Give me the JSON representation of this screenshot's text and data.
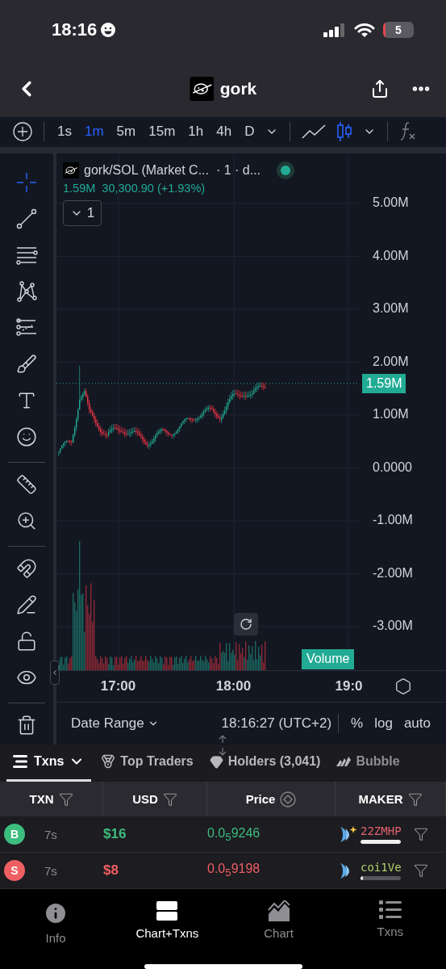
{
  "status_bar": {
    "time": "18:16",
    "battery": "5"
  },
  "header": {
    "title": "gork"
  },
  "toolbar": {
    "intervals": [
      {
        "label": "1s",
        "selected": false
      },
      {
        "label": "1m",
        "selected": true
      },
      {
        "label": "5m",
        "selected": false
      },
      {
        "label": "15m",
        "selected": false
      },
      {
        "label": "1h",
        "selected": false
      },
      {
        "label": "4h",
        "selected": false
      },
      {
        "label": "D",
        "selected": false
      }
    ],
    "chart_types": [
      {
        "kind": "line",
        "selected": false
      },
      {
        "kind": "candles",
        "selected": true
      }
    ]
  },
  "drawing_tools": [
    {
      "kind": "crosshair",
      "selected": true
    },
    {
      "kind": "trend-line",
      "selected": false
    },
    {
      "kind": "channel",
      "selected": false
    },
    {
      "kind": "pattern",
      "selected": false
    },
    {
      "kind": "projection",
      "selected": false
    },
    {
      "kind": "brush",
      "selected": false
    },
    {
      "kind": "text",
      "selected": false
    },
    {
      "kind": "emoji",
      "selected": false
    },
    {
      "kind": "divider"
    },
    {
      "kind": "ruler",
      "selected": false
    },
    {
      "kind": "zoom",
      "selected": false
    },
    {
      "kind": "divider"
    },
    {
      "kind": "magnet",
      "selected": false
    },
    {
      "kind": "lock-drawing",
      "selected": false
    },
    {
      "kind": "unlock",
      "selected": false
    },
    {
      "kind": "eye",
      "selected": false
    },
    {
      "kind": "divider"
    },
    {
      "kind": "trash",
      "selected": false
    }
  ],
  "chart": {
    "legend_title": "gork/SOL (Market C...  · 1 · d...",
    "legend_values": "1.59M  30,300.90 (+1.93%)",
    "indicators_count": "1",
    "live": true,
    "price_axis": [
      "5.00M",
      "4.00M",
      "3.00M",
      "2.00M",
      "1.00M",
      "0.0000",
      "-1.00M",
      "-2.00M",
      "-3.00M"
    ],
    "last_price": "1.59M",
    "volume_label": "Volume",
    "time_axis": [
      "17:00",
      "18:00",
      "19:0"
    ],
    "date_range": "Date Range",
    "clock": "18:16:27 (UTC+2)",
    "scale_options": [
      "%",
      "log",
      "auto"
    ]
  },
  "tabs": [
    {
      "label": "Txns",
      "selected": true
    },
    {
      "label": "Top Traders",
      "selected": false
    },
    {
      "label": "Holders (3,041)",
      "selected": false
    },
    {
      "label": "Bubble",
      "selected": false
    }
  ],
  "table": {
    "columns": [
      "TXN",
      "USD",
      "Price",
      "MAKER"
    ],
    "rows": [
      {
        "kind": "buy",
        "badge": "B",
        "age": "7s",
        "usd": "$16",
        "price": "0.0$_{5}$9246",
        "maker": {
          "name": "22ZMHP",
          "color": "#e2616a",
          "sparkle": true,
          "level": 1
        }
      },
      {
        "kind": "sell",
        "badge": "S",
        "age": "7s",
        "usd": "$8",
        "price": "0.0$_{5}$9198",
        "maker": {
          "name": "coi1Ve",
          "color": "#b6cf6a",
          "sparkle": false,
          "level": 0.06
        }
      }
    ]
  },
  "bottom_nav": [
    {
      "label": "Info",
      "selected": false
    },
    {
      "label": "Chart+Txns",
      "selected": true
    },
    {
      "label": "Chart",
      "selected": false
    },
    {
      "label": "Txns",
      "selected": false
    }
  ]
}
